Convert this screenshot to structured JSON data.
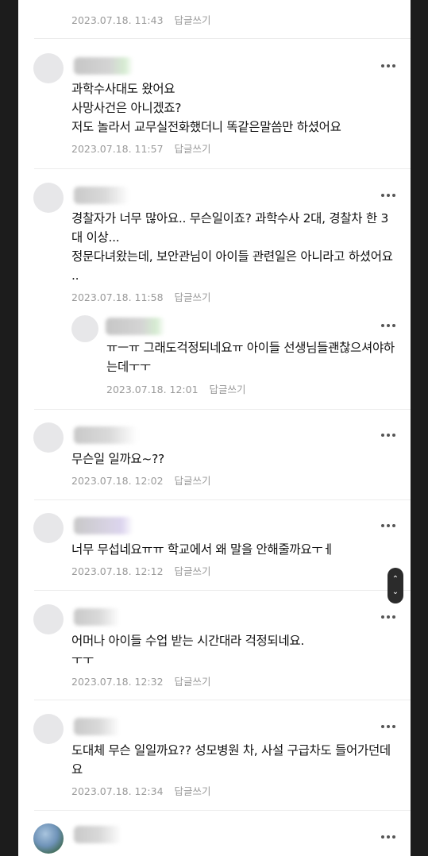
{
  "comments": [
    {
      "text": "",
      "date": "2023.07.18. 11:43",
      "reply_label": "답글쓰기"
    },
    {
      "text": "과학수사대도 왔어요\n사망사건은 아니겠죠?\n저도 놀라서 교무실전화했더니 똑같은말씀만 하셨어요",
      "date": "2023.07.18. 11:57",
      "reply_label": "답글쓰기"
    },
    {
      "text": "경찰자가 너무 많아요.. 무슨일이죠? 과학수사 2대, 경찰차 한 3대 이상...\n정문다녀왔는데, 보안관님이 아이들 관련일은 아니라고 하셨어요 ..",
      "date": "2023.07.18. 11:58",
      "reply_label": "답글쓰기"
    },
    {
      "text": "ㅠㅡㅠ 그래도걱정되네요ㅠ 아이들 선생님들괜찮으셔야하는데ㅜㅜ",
      "date": "2023.07.18. 12:01",
      "reply_label": "답글쓰기"
    },
    {
      "text": "무슨일 일까요~??",
      "date": "2023.07.18. 12:02",
      "reply_label": "답글쓰기"
    },
    {
      "text": "너무 무섭네요ㅠㅠ 학교에서 왜 말을 안해줄까요ㅜㅔ",
      "date": "2023.07.18. 12:12",
      "reply_label": "답글쓰기"
    },
    {
      "text": "어머나 아이들 수업 받는 시간대라 걱정되네요.\nㅜㅜ",
      "date": "2023.07.18. 12:32",
      "reply_label": "답글쓰기"
    },
    {
      "text": "도대체 무슨 일일까요?? 성모병원 차, 사설 구급차도 들어가던데요",
      "date": "2023.07.18. 12:34",
      "reply_label": "답글쓰기"
    },
    {
      "text": "",
      "date": "",
      "reply_label": ""
    }
  ],
  "icons": {
    "more": "more-horizontal-icon",
    "scroll_up": "chevron-up-icon",
    "scroll_down": "chevron-down-icon"
  },
  "colors": {
    "text": "#111111",
    "meta": "#9a9a9a",
    "background": "#ffffff",
    "frame": "#1c1c1c"
  }
}
